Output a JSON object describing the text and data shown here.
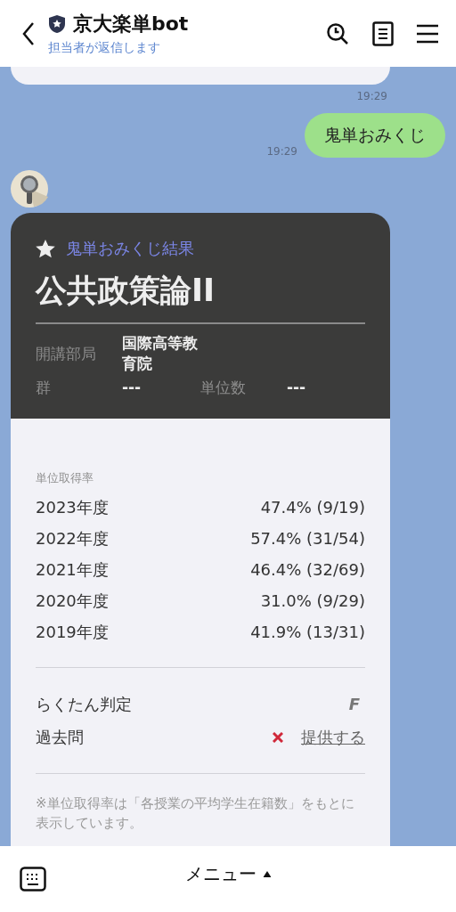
{
  "header": {
    "title": "京大楽単bot",
    "subtitle": "担当者が返信します"
  },
  "messages": [
    {
      "kind": "clipped",
      "time": "19:29"
    },
    {
      "kind": "user",
      "text": "鬼単おみくじ",
      "time": "19:29"
    },
    {
      "kind": "card",
      "label": "鬼単おみくじ結果",
      "course": "公共政策論II",
      "info_rows": [
        [
          {
            "label": "開講部局",
            "value": "国際高等教育院"
          }
        ],
        [
          {
            "label": "群",
            "value": "---"
          },
          {
            "label": "単位数",
            "value": "---"
          }
        ]
      ],
      "rates": {
        "heading": "単位取得率",
        "rows": [
          {
            "year": "2023年度",
            "value": "47.4% (9/19)"
          },
          {
            "year": "2022年度",
            "value": "57.4% (31/54)"
          },
          {
            "year": "2021年度",
            "value": "46.4% (32/69)"
          },
          {
            "year": "2020年度",
            "value": "31.0% (9/29)"
          },
          {
            "year": "2019年度",
            "value": "41.9% (13/31)"
          }
        ]
      },
      "judgement": {
        "label": "らくたん判定",
        "grade": "F"
      },
      "past_exams": {
        "label": "過去問",
        "available": false,
        "link": "提供する"
      },
      "note": "※単位取得率は「各授業の平均学生在籍数」をもとに表示しています。"
    }
  ],
  "bottom_bar": {
    "menu": "メニュー"
  }
}
